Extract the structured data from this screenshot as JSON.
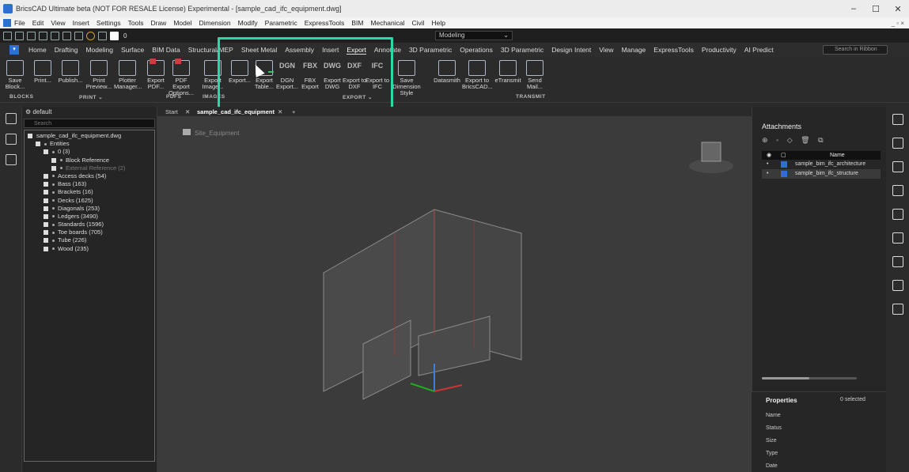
{
  "window": {
    "title": "BricsCAD Ultimate beta (NOT FOR RESALE License) Experimental - [sample_cad_ifc_equipment.dwg]",
    "controls": [
      "–",
      "☐",
      "✕"
    ]
  },
  "menubar": {
    "items": [
      "File",
      "Edit",
      "View",
      "Insert",
      "Settings",
      "Tools",
      "Draw",
      "Model",
      "Dimension",
      "Modify",
      "Parametric",
      "ExpressTools",
      "BIM",
      "Mechanical",
      "Civil",
      "Help"
    ],
    "right": "_ ▫ ×"
  },
  "qat": {
    "layer": "0",
    "workspace": "Modeling",
    "caret": "⌄"
  },
  "ribbon_tabs": [
    "Home",
    "Drafting",
    "Modeling",
    "Surface",
    "BIM Data",
    "Structural/MEP",
    "Sheet Metal",
    "Assembly",
    "Insert",
    "Export",
    "Annotate",
    "3D Parametric",
    "Operations",
    "3D Parametric",
    "Design Intent",
    "View",
    "Manage",
    "ExpressTools",
    "Productivity",
    "AI Predict"
  ],
  "ribbon_active": "Export",
  "ribbon_search": "Search in Ribbon",
  "ribbon": {
    "buttons": [
      "Save Block...",
      "Print...",
      "Publish...",
      "Print Preview...",
      "Plotter Manager...",
      "Export PDF...",
      "PDF Export Options...",
      "Export Image...",
      "Export...",
      "Export Table...",
      "DGN Export...",
      "FBX Export",
      "Export DWG",
      "Export to DXF",
      "Export to IFC",
      "Save Dimension Style",
      "Datasmith",
      "Export to BricsCAD...",
      "eTransmit",
      "Send Mail..."
    ],
    "format_icons": [
      "DGN",
      "FBX",
      "DWG",
      "DXF",
      "IFC"
    ],
    "groups": [
      "BLOCKS",
      "PRINT ⌄",
      "PDFS",
      "IMAGES",
      "EXPORT ⌄",
      "TRANSMIT"
    ]
  },
  "tree": {
    "header": "default",
    "search": "Search",
    "rows": [
      {
        "label": "sample_cad_ifc_equipment.dwg",
        "dim": false
      },
      {
        "label": "Entities",
        "dim": false
      },
      {
        "label": "0 (3)",
        "dim": false
      },
      {
        "label": "Block Reference",
        "dim": false
      },
      {
        "label": "External Reference (2)",
        "dim": true
      },
      {
        "label": "Access decks (54)",
        "dim": false
      },
      {
        "label": "Bass (163)",
        "dim": false
      },
      {
        "label": "Brackets (16)",
        "dim": false
      },
      {
        "label": "Decks (1625)",
        "dim": false
      },
      {
        "label": "Diagonals (253)",
        "dim": false
      },
      {
        "label": "Ledgers (3490)",
        "dim": false
      },
      {
        "label": "Standards (1596)",
        "dim": false
      },
      {
        "label": "Toe boards (705)",
        "dim": false
      },
      {
        "label": "Tube (226)",
        "dim": false
      },
      {
        "label": "Wood (235)",
        "dim": false
      }
    ]
  },
  "viewport": {
    "tabs": [
      "Start",
      "sample_cad_ifc_equipment"
    ],
    "breadcrumb": "Site_Equipment",
    "tab_close": "✕",
    "tab_add": "+"
  },
  "attachments": {
    "title": "Attachments",
    "tools": "⊕ ◦ ◇ 🗑 ⧉",
    "column": "Name",
    "rows": [
      {
        "name": "sample_bim_ifc_architecture"
      },
      {
        "name": "sample_bim_ifc_structure"
      }
    ]
  },
  "properties": {
    "title": "Properties",
    "selected": "0 selected",
    "fields": [
      "Name",
      "Status",
      "Size",
      "Type",
      "Date"
    ]
  },
  "colors": {
    "highlight": "#2ad9a8",
    "accent": "#2f6fd1"
  }
}
